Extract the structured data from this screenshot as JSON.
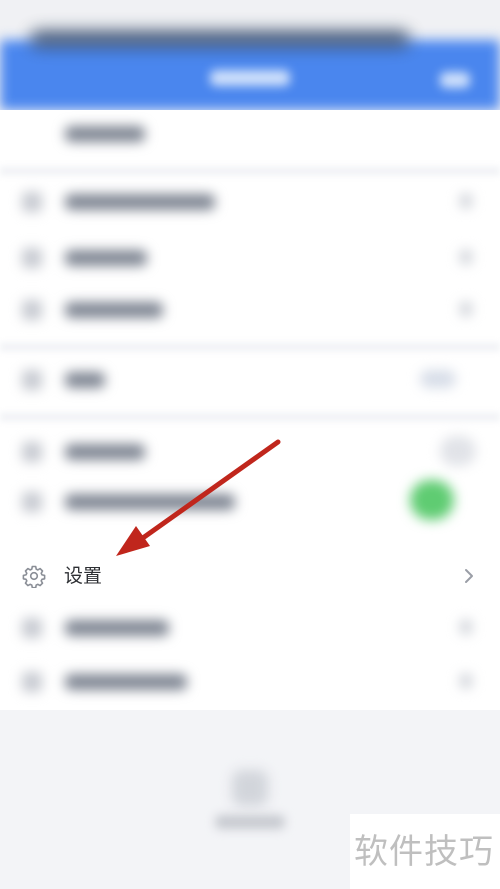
{
  "menu": {
    "settings_label": "设置"
  },
  "watermark": {
    "text": "软件技巧"
  },
  "colors": {
    "header": "#4a86ee",
    "toggle_on": "#5fcc72",
    "annotation_arrow": "#c0261c"
  },
  "icons": {
    "settings": "gear-icon",
    "chevron": "chevron-right-icon"
  }
}
